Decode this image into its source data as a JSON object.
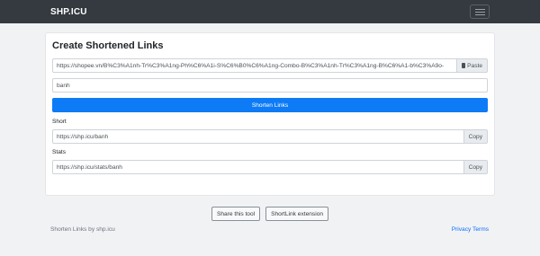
{
  "navbar": {
    "brand": "SHP.ICU",
    "menu_icon": "hamburger-menu-icon"
  },
  "form": {
    "title": "Create Shortened Links",
    "url_value": "https://shopee.vn/B%C3%A1nh-Tr%C3%A1ng-Ph%C6%A1i-S%C6%B0%C6%A1ng-Combo-B%C3%A1nh-Tr%C3%A1ng-B%C6%A1-b%C3%A9o-",
    "paste_label": "Paste",
    "paste_icon": "clipboard-icon",
    "alias_value": "banh",
    "shorten_label": "Shorten Links"
  },
  "results": {
    "short_label": "Short",
    "short_value": "https://shp.icu/banh",
    "stats_label": "Stats",
    "stats_value": "https://shp.icu/stats/banh",
    "copy_label": "Copy"
  },
  "actions": {
    "share_label": "Share this tool",
    "extension_label": "ShortLink extension"
  },
  "footer": {
    "left_text": "Shorten Links by shp.icu",
    "privacy_label": "Privacy",
    "terms_label": "Terms"
  },
  "colors": {
    "navbar": "#343a40",
    "primary": "#0d7bf6",
    "link": "#0d6efd"
  }
}
